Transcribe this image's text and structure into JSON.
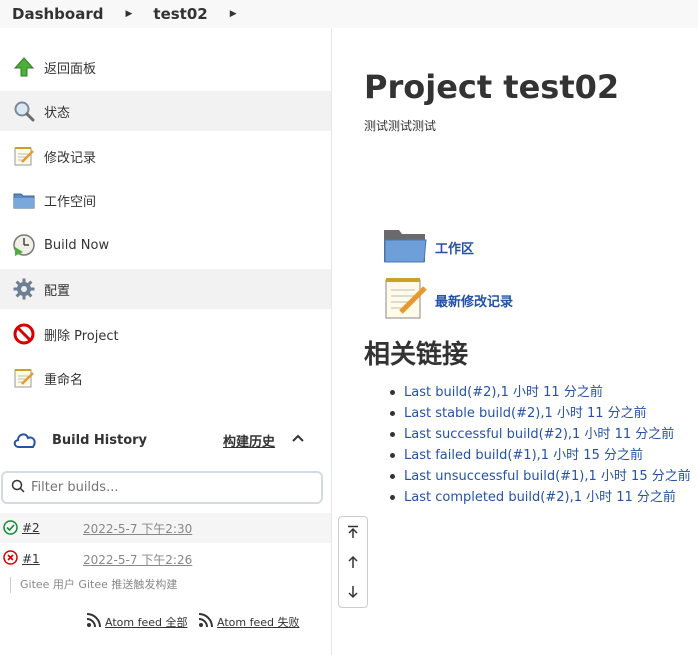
{
  "breadcrumb": {
    "items": [
      "Dashboard",
      "test02"
    ]
  },
  "sidebar": {
    "tasks": [
      {
        "label": "返回面板",
        "icon": "up-arrow-icon"
      },
      {
        "label": "状态",
        "icon": "search-icon"
      },
      {
        "label": "修改记录",
        "icon": "notepad-icon"
      },
      {
        "label": "工作空间",
        "icon": "folder-icon"
      },
      {
        "label": "Build Now",
        "icon": "build-now-icon"
      },
      {
        "label": "配置",
        "icon": "gear-icon"
      },
      {
        "label": "删除 Project",
        "icon": "no-entry-icon"
      },
      {
        "label": "重命名",
        "icon": "notepad-icon"
      }
    ]
  },
  "build_history": {
    "title": "Build History",
    "trend_label": "构建历史",
    "filter_placeholder": "Filter builds...",
    "builds": [
      {
        "number": "#2",
        "date": "2022-5-7 下午2:30",
        "status": "success"
      },
      {
        "number": "#1",
        "date": "2022-5-7 下午2:26",
        "status": "failed"
      }
    ],
    "build_description": "Gitee 用户 Gitee 推送触发构建",
    "feeds": [
      {
        "label": "Atom feed 全部"
      },
      {
        "label": "Atom feed 失败"
      }
    ]
  },
  "main": {
    "title": "Project test02",
    "description": "测试测试测试",
    "workspace_link": "工作区",
    "changes_link": "最新修改记录",
    "related_title": "相关链接",
    "permalinks": [
      "Last build(#2),1 小时 11 分之前",
      "Last stable build(#2),1 小时 11 分之前",
      "Last successful build(#2),1 小时 11 分之前",
      "Last failed build(#1),1 小时 15 分之前",
      "Last unsuccessful build(#1),1 小时 15 分之前",
      "Last completed build(#2),1 小时 11 分之前"
    ]
  },
  "colors": {
    "link": "#2552a5",
    "success": "#138a36",
    "failed": "#d40000"
  }
}
